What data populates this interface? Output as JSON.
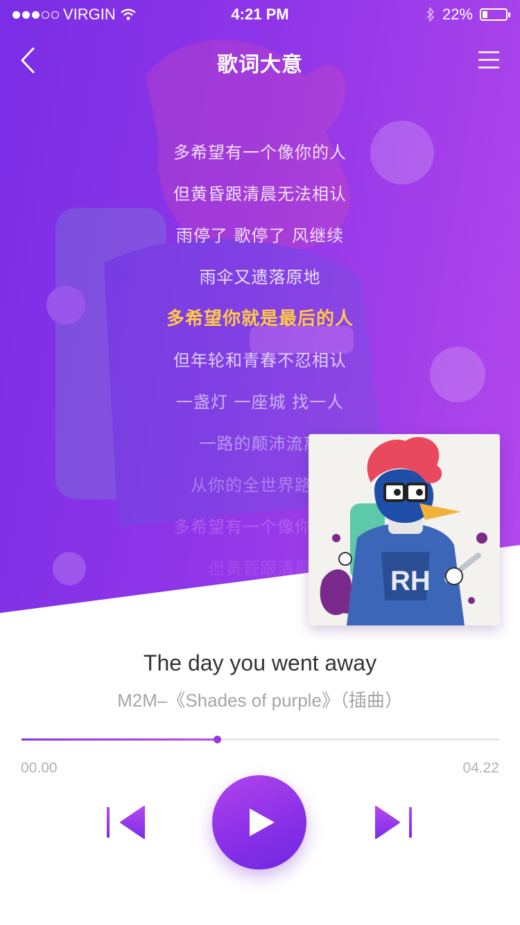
{
  "status_bar": {
    "carrier": "VIRGIN",
    "time": "4:21 PM",
    "battery": "22%",
    "battery_level": 0.22,
    "signal_bars": 3,
    "signal_total": 5
  },
  "header": {
    "title": "歌词大意",
    "back_icon": "chevron-left-icon",
    "menu_icon": "hamburger-menu-icon"
  },
  "lyrics": [
    {
      "text": "多希望有一个像你的人",
      "opacity": 0.85
    },
    {
      "text": "但黄昏跟清晨无法相认",
      "opacity": 0.85
    },
    {
      "text": "雨停了 歌停了 风继续",
      "opacity": 0.85
    },
    {
      "text": "雨伞又遗落原地",
      "opacity": 0.85
    },
    {
      "text": "多希望你就是最后的人",
      "opacity": 1,
      "active": true
    },
    {
      "text": "但年轮和青春不忍相认",
      "opacity": 0.75
    },
    {
      "text": "一盏灯 一座城 找一人",
      "opacity": 0.6
    },
    {
      "text": "一路的颠沛流离",
      "opacity": 0.45
    },
    {
      "text": "从你的全世界路过",
      "opacity": 0.32
    },
    {
      "text": "多希望有一个像你的人",
      "opacity": 0.2
    },
    {
      "text": "但黄昏跟清晨",
      "opacity": 0.1
    }
  ],
  "song": {
    "title": "The day you went away",
    "subtitle": "M2M–《Shades of purple》（插曲）"
  },
  "progress": {
    "current": "00.00",
    "total": "04.22",
    "fraction": 0.41
  },
  "colors": {
    "accent": "#9b36e6",
    "active_lyric": "#ffc949",
    "hero_start": "#7a2ee6",
    "hero_end": "#b348ec"
  },
  "controls": {
    "prev_icon": "skip-previous-icon",
    "play_icon": "play-icon",
    "next_icon": "skip-next-icon"
  }
}
